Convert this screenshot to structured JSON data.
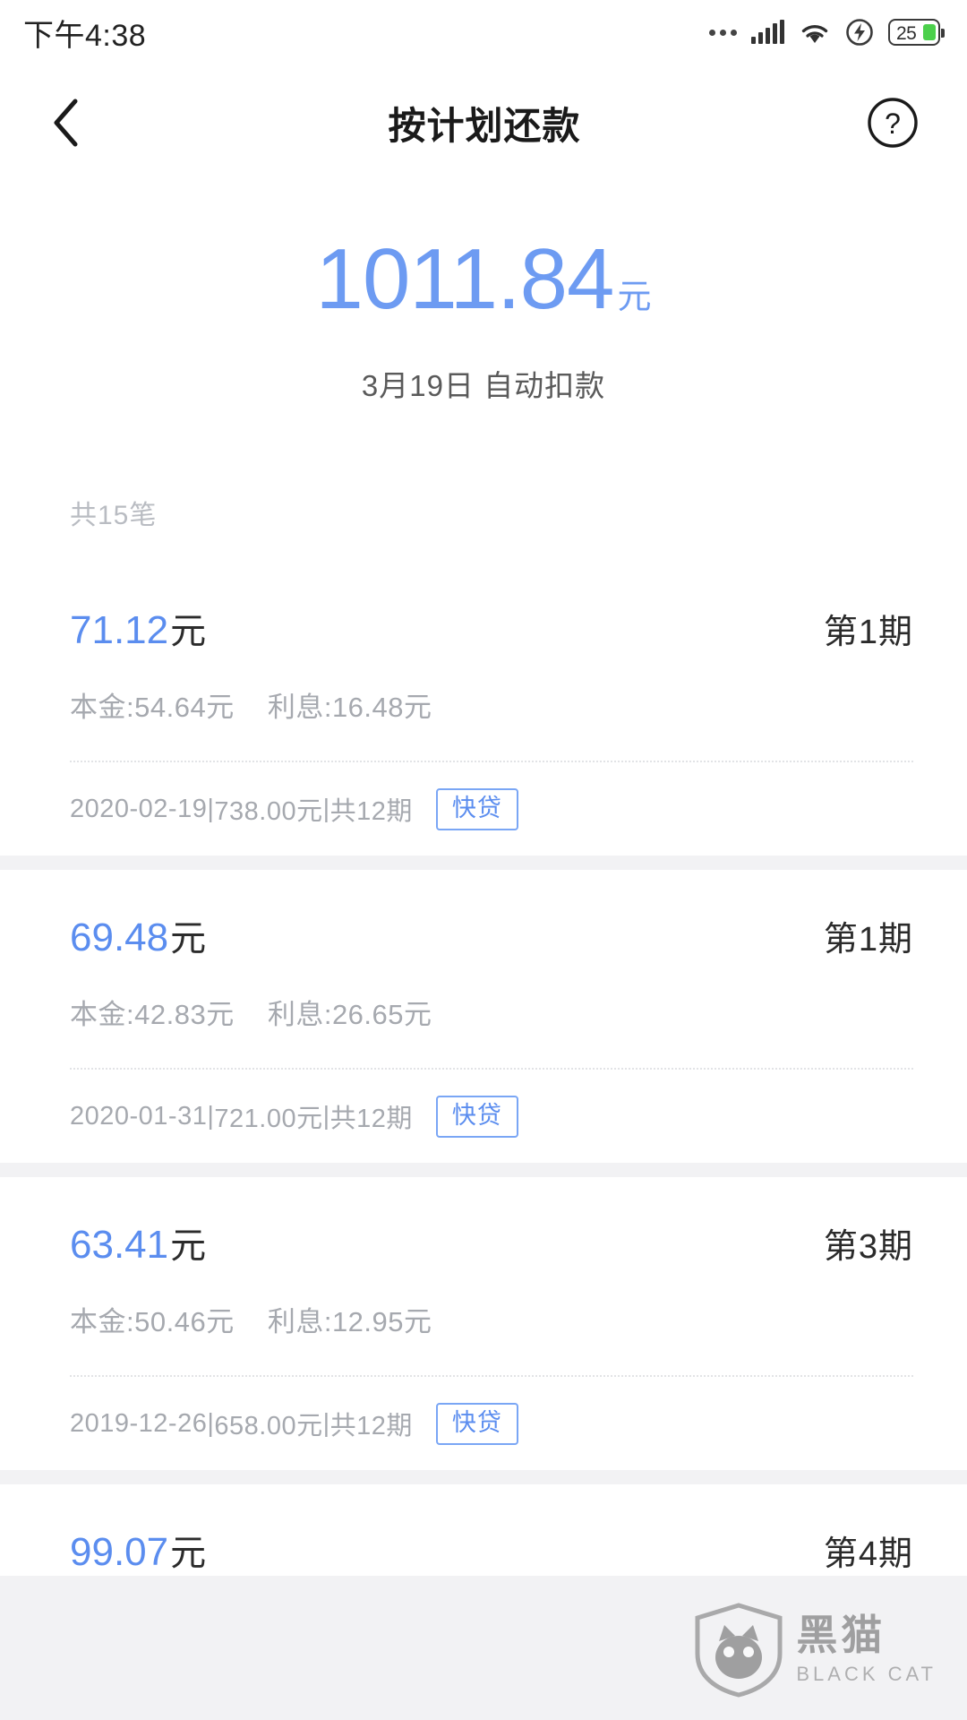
{
  "status_bar": {
    "time": "下午4:38",
    "battery_level": "25",
    "icons": [
      "more-dots-icon",
      "signal-icon",
      "wifi-icon",
      "charging-icon",
      "battery-icon"
    ]
  },
  "nav": {
    "back_icon": "chevron-left-icon",
    "title": "按计划还款",
    "help_icon": "question-mark-icon"
  },
  "hero": {
    "amount": "1011.84",
    "unit": "元",
    "subtitle": "3月19日 自动扣款",
    "accent_color": "#6d9bf2"
  },
  "summary": {
    "count_label": "共15笔"
  },
  "list": {
    "items": [
      {
        "amount": "71.12",
        "unit": "元",
        "term": "第1期",
        "principal_label": "本金:54.64元",
        "interest_label": "利息:16.48元",
        "date": "2020-02-19",
        "total_amount": "738.00元",
        "periods": "共12期",
        "badge": "快贷",
        "separator": "|"
      },
      {
        "amount": "69.48",
        "unit": "元",
        "term": "第1期",
        "principal_label": "本金:42.83元",
        "interest_label": "利息:26.65元",
        "date": "2020-01-31",
        "total_amount": "721.00元",
        "periods": "共12期",
        "badge": "快贷",
        "separator": "|"
      },
      {
        "amount": "63.41",
        "unit": "元",
        "term": "第3期",
        "principal_label": "本金:50.46元",
        "interest_label": "利息:12.95元",
        "date": "2019-12-26",
        "total_amount": "658.00元",
        "periods": "共12期",
        "badge": "快贷",
        "separator": "|"
      },
      {
        "amount": "99.07",
        "unit": "元",
        "term": "第4期",
        "principal_label": "",
        "interest_label": "",
        "date": "",
        "total_amount": "",
        "periods": "",
        "badge": "",
        "separator": ""
      }
    ]
  },
  "watermark": {
    "text_cn": "黑猫",
    "text_en": "BLACK CAT",
    "shield_icon": "shield-cat-icon"
  }
}
